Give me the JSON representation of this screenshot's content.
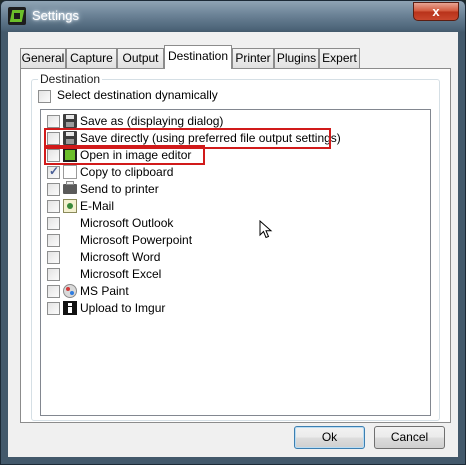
{
  "window": {
    "title": "Settings",
    "close_label": "x"
  },
  "tabs": [
    {
      "label": "General",
      "active": false
    },
    {
      "label": "Capture",
      "active": false
    },
    {
      "label": "Output",
      "active": false
    },
    {
      "label": "Destination",
      "active": true
    },
    {
      "label": "Printer",
      "active": false
    },
    {
      "label": "Plugins",
      "active": false
    },
    {
      "label": "Expert",
      "active": false
    }
  ],
  "destination": {
    "group_label": "Destination",
    "dynamic_label": "Select destination dynamically",
    "dynamic_checked": false,
    "items": [
      {
        "label": "Save as (displaying dialog)",
        "checked": false,
        "icon": "floppy-icon"
      },
      {
        "label": "Save directly (using preferred file output settings)",
        "checked": false,
        "icon": "floppy-icon"
      },
      {
        "label": "Open in image editor",
        "checked": false,
        "icon": "image-editor-icon"
      },
      {
        "label": "Copy to clipboard",
        "checked": true,
        "icon": "clipboard-icon"
      },
      {
        "label": "Send to printer",
        "checked": false,
        "icon": "printer-icon"
      },
      {
        "label": "E-Mail",
        "checked": false,
        "icon": "email-icon"
      },
      {
        "label": "Microsoft Outlook",
        "checked": false,
        "icon": ""
      },
      {
        "label": "Microsoft Powerpoint",
        "checked": false,
        "icon": ""
      },
      {
        "label": "Microsoft Word",
        "checked": false,
        "icon": ""
      },
      {
        "label": "Microsoft Excel",
        "checked": false,
        "icon": ""
      },
      {
        "label": "MS Paint",
        "checked": false,
        "icon": "paint-icon"
      },
      {
        "label": "Upload to Imgur",
        "checked": false,
        "icon": "imgur-icon"
      }
    ]
  },
  "buttons": {
    "ok": "Ok",
    "cancel": "Cancel"
  },
  "colors": {
    "highlight": "#d11a1a",
    "title_bar": "#4c6478"
  }
}
